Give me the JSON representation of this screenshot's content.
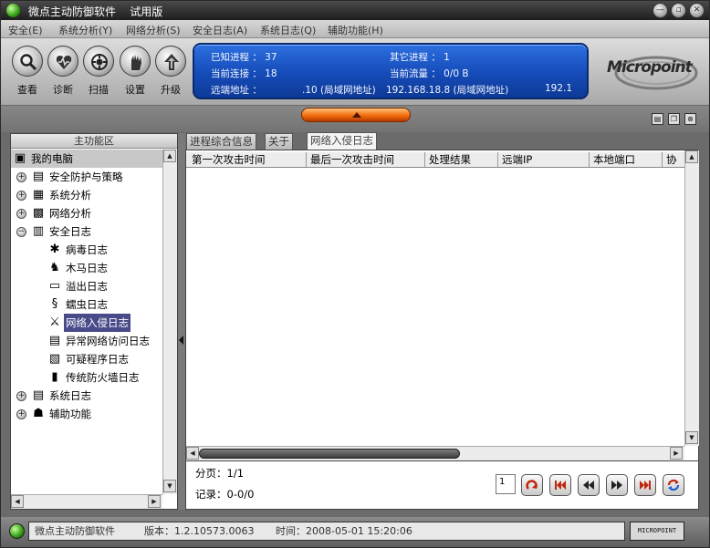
{
  "window": {
    "title": "微点主动防御软件",
    "edition": "试用版"
  },
  "menu": [
    "安全(E)",
    "系统分析(Y)",
    "网络分析(S)",
    "安全日志(A)",
    "系统日志(Q)",
    "辅助功能(H)"
  ],
  "toolbar": [
    {
      "label": "查看",
      "icon": "view-icon"
    },
    {
      "label": "诊断",
      "icon": "diagnose-icon"
    },
    {
      "label": "扫描",
      "icon": "scan-icon"
    },
    {
      "label": "设置",
      "icon": "settings-icon"
    },
    {
      "label": "升级",
      "icon": "upgrade-icon"
    }
  ],
  "info": {
    "known_proc": "已知进程 ： 37",
    "other_proc": "其它进程 ： 1",
    "conn": "当前连接 ： 18",
    "traffic": "当前流量 ： 0/0 B",
    "remote_label": "远端地址 ：",
    "remote_val": ".10 (局域网地址)",
    "remote_val2": "192.168.18.8 (局域网地址)",
    "remote_val3": "192.1"
  },
  "brand": {
    "logo": "Micropoint",
    "status_logo": "MICROPOINT"
  },
  "left": {
    "header": "主功能区",
    "tree": [
      {
        "label": "我的电脑",
        "icon": "computer-icon",
        "level": 0,
        "expander": "",
        "root": true
      },
      {
        "label": "安全防护与策略",
        "icon": "policy-icon",
        "level": 1,
        "expander": "+"
      },
      {
        "label": "系统分析",
        "icon": "system-analysis-icon",
        "level": 1,
        "expander": "+"
      },
      {
        "label": "网络分析",
        "icon": "network-analysis-icon",
        "level": 1,
        "expander": "+"
      },
      {
        "label": "安全日志",
        "icon": "security-log-icon",
        "level": 1,
        "expander": "−"
      },
      {
        "label": "病毒日志",
        "icon": "virus-log-icon",
        "level": 2
      },
      {
        "label": "木马日志",
        "icon": "trojan-log-icon",
        "level": 2
      },
      {
        "label": "溢出日志",
        "icon": "overflow-log-icon",
        "level": 2
      },
      {
        "label": "蠕虫日志",
        "icon": "worm-log-icon",
        "level": 2
      },
      {
        "label": "网络入侵日志",
        "icon": "intrusion-log-icon",
        "level": 2,
        "selected": true
      },
      {
        "label": "异常网络访问日志",
        "icon": "abnormal-access-log-icon",
        "level": 2
      },
      {
        "label": "可疑程序日志",
        "icon": "suspicious-program-log-icon",
        "level": 2
      },
      {
        "label": "传统防火墙日志",
        "icon": "firewall-log-icon",
        "level": 2
      },
      {
        "label": "系统日志",
        "icon": "system-log-icon",
        "level": 1,
        "expander": "+"
      },
      {
        "label": "辅助功能",
        "icon": "tools-icon",
        "level": 1,
        "expander": "+"
      }
    ]
  },
  "tabs": [
    "进程综合信息",
    "关于",
    "网络入侵日志"
  ],
  "columns": [
    "第一次攻击时间",
    "最后一次攻击时间",
    "处理结果",
    "远端IP",
    "本地端口",
    "协"
  ],
  "footer": {
    "page": "分页：1/1",
    "records": "记录：0-0/0",
    "page_input": "1"
  },
  "status": {
    "product": "微点主动防御软件",
    "version": "版本：1.2.10573.0063",
    "time": "时间：2008-05-01 15:20:06"
  },
  "colors": {
    "accent": "#1a55c8",
    "pill": "#f36b0b",
    "selection": "#4a4a8a"
  }
}
